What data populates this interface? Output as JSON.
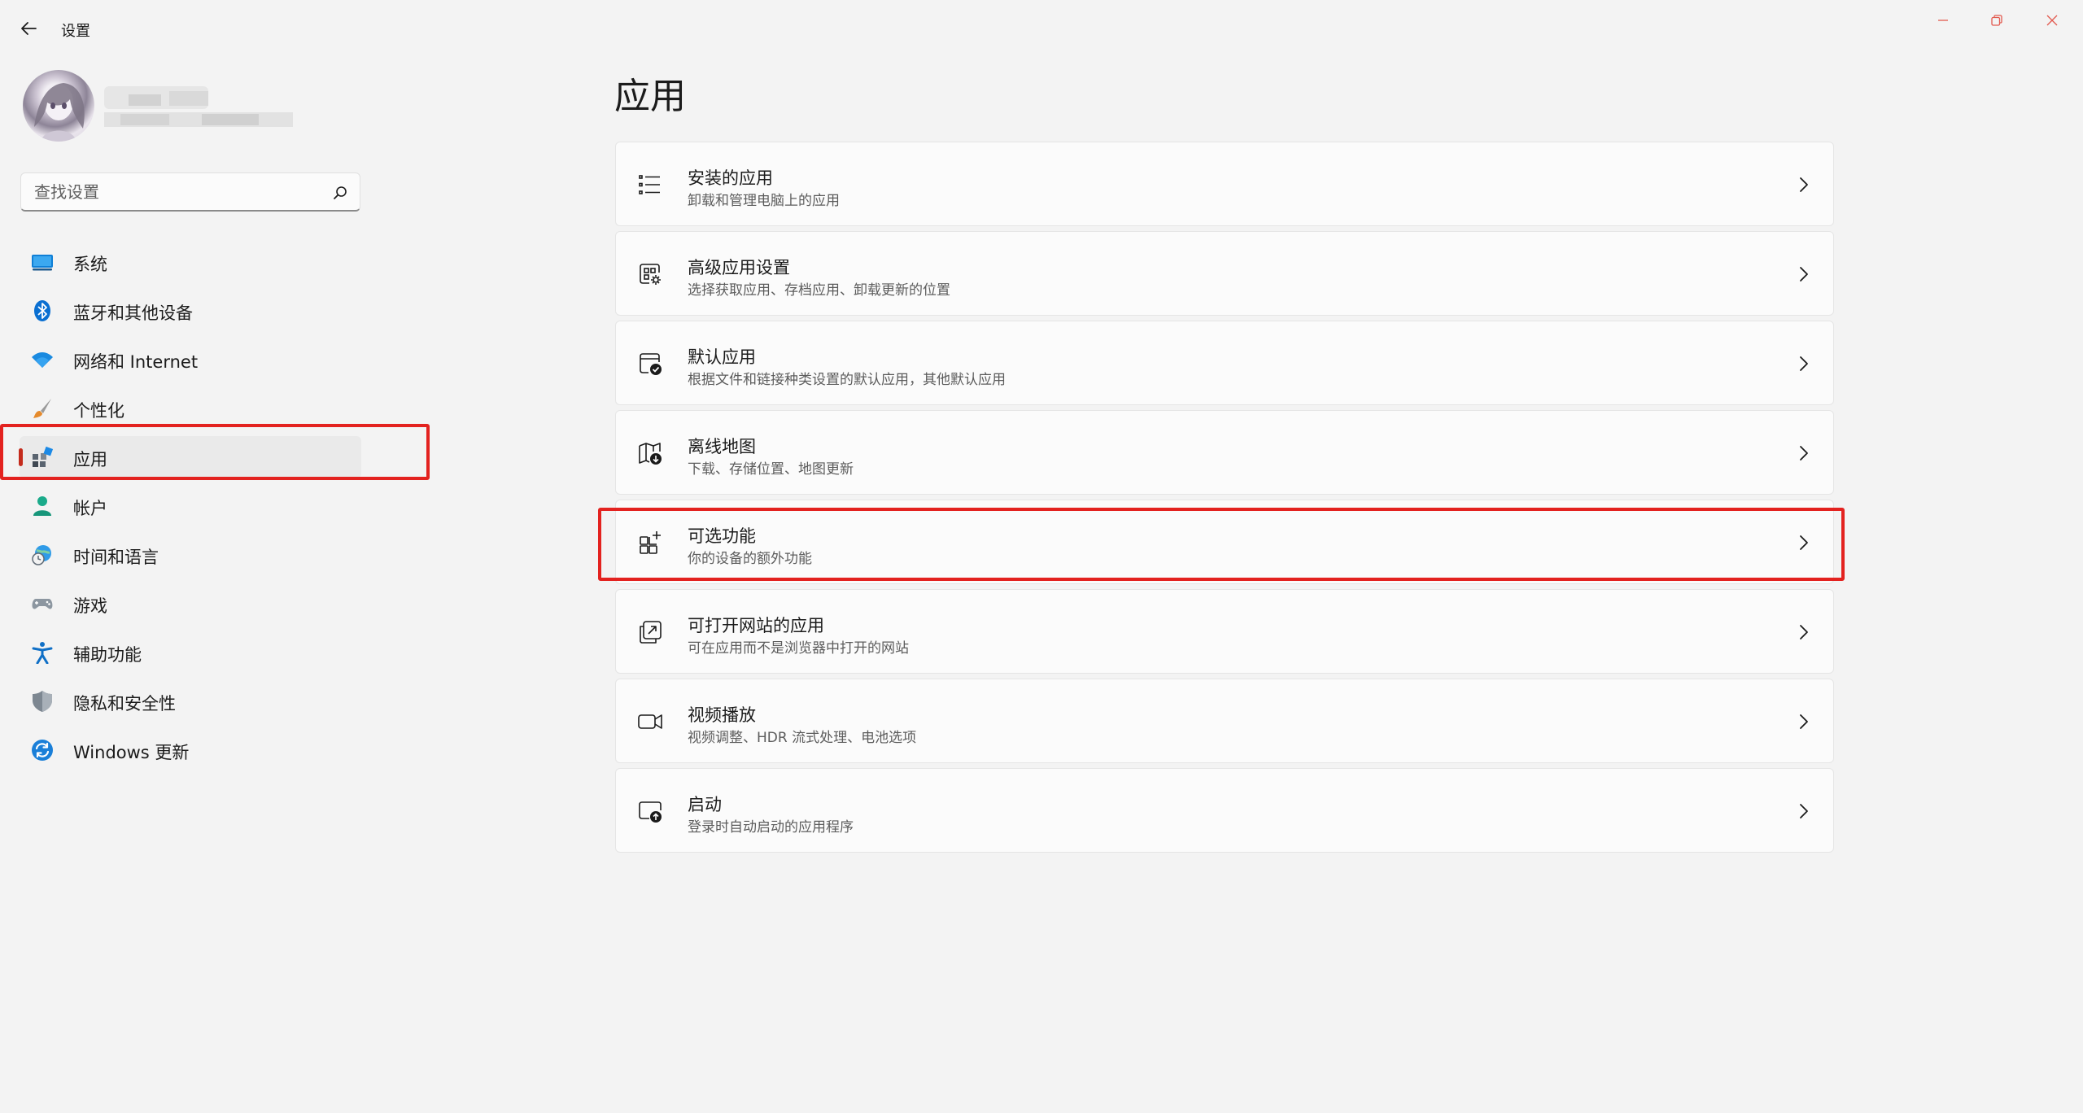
{
  "window": {
    "title": "设置",
    "back_icon": "back-arrow-icon",
    "controls": [
      "minimize-icon",
      "restore-icon",
      "close-icon"
    ],
    "control_color": "#e25a4f"
  },
  "search": {
    "placeholder": "查找设置",
    "icon": "search-icon"
  },
  "sidebar": {
    "selected_index": 4,
    "accent": "#c42b1c",
    "items": [
      {
        "label": "系统",
        "icon": "system-display-icon"
      },
      {
        "label": "蓝牙和其他设备",
        "icon": "bluetooth-icon"
      },
      {
        "label": "网络和 Internet",
        "icon": "wifi-icon"
      },
      {
        "label": "个性化",
        "icon": "brush-icon"
      },
      {
        "label": "应用",
        "icon": "apps-icon"
      },
      {
        "label": "帐户",
        "icon": "account-icon"
      },
      {
        "label": "时间和语言",
        "icon": "globe-clock-icon"
      },
      {
        "label": "游戏",
        "icon": "gamepad-icon"
      },
      {
        "label": "辅助功能",
        "icon": "accessibility-icon"
      },
      {
        "label": "隐私和安全性",
        "icon": "shield-icon"
      },
      {
        "label": "Windows 更新",
        "icon": "windows-update-icon"
      }
    ]
  },
  "main": {
    "title": "应用",
    "cards": [
      {
        "title": "安装的应用",
        "subtitle": "卸载和管理电脑上的应用",
        "icon": "list-icon"
      },
      {
        "title": "高级应用设置",
        "subtitle": "选择获取应用、存档应用、卸载更新的位置",
        "icon": "app-settings-gear-icon"
      },
      {
        "title": "默认应用",
        "subtitle": "根据文件和链接种类设置的默认应用，其他默认应用",
        "icon": "default-apps-check-icon"
      },
      {
        "title": "离线地图",
        "subtitle": "下载、存储位置、地图更新",
        "icon": "offline-map-icon"
      },
      {
        "title": "可选功能",
        "subtitle": "你的设备的额外功能",
        "icon": "optional-features-icon"
      },
      {
        "title": "可打开网站的应用",
        "subtitle": "可在应用而不是浏览器中打开的网站",
        "icon": "open-web-icon"
      },
      {
        "title": "视频播放",
        "subtitle": "视频调整、HDR 流式处理、电池选项",
        "icon": "video-camera-icon"
      },
      {
        "title": "启动",
        "subtitle": "登录时自动启动的应用程序",
        "icon": "startup-icon"
      }
    ],
    "highlight_color": "#e3221f"
  }
}
